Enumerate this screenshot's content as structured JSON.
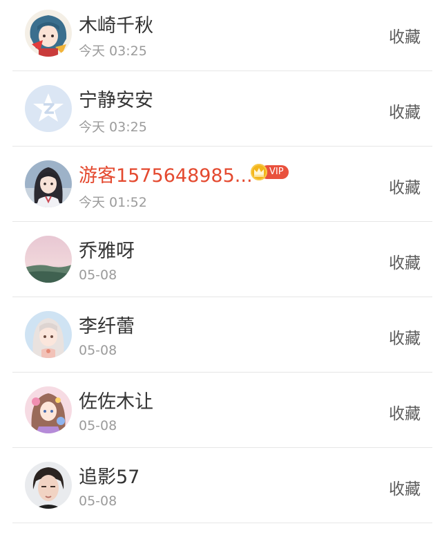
{
  "list": {
    "action_label": "收藏",
    "items": [
      {
        "name": "木崎千秋",
        "time": "今天 03:25",
        "avatar": "anime-girl-avatar"
      },
      {
        "name": "宁静安安",
        "time": "今天 03:25",
        "avatar": "default-star-avatar"
      },
      {
        "name": "游客1575648985...",
        "time": "今天 01:52",
        "avatar": "anime-girl-dark-hair-avatar",
        "vip": "VIP"
      },
      {
        "name": "乔雅呀",
        "time": "05-08",
        "avatar": "landscape-sunset-avatar"
      },
      {
        "name": "李纤蕾",
        "time": "05-08",
        "avatar": "anime-girl-silver-hair-avatar"
      },
      {
        "name": "佐佐木让",
        "time": "05-08",
        "avatar": "anime-girl-colorful-avatar"
      },
      {
        "name": "追影57",
        "time": "05-08",
        "avatar": "young-man-photo-avatar"
      }
    ]
  },
  "colors": {
    "name_text": "#333333",
    "vip_name_text": "#e4492f",
    "time_text": "#9b9b9b",
    "action_text": "#5c5c5c",
    "vip_pill": "#e9513d",
    "crown": "#f3b51b",
    "divider": "#e6e6e6"
  }
}
